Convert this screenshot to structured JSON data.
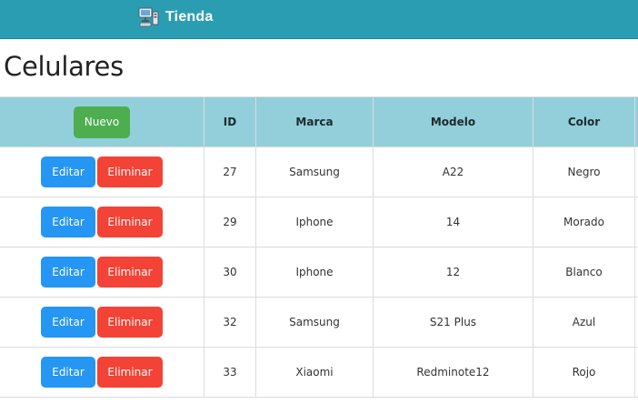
{
  "nav": {
    "brand": "Tienda",
    "brand_icon": "computer-store-icon"
  },
  "page": {
    "title": "Celulares"
  },
  "table": {
    "new_label": "Nuevo",
    "headers": [
      "ID",
      "Marca",
      "Modelo",
      "Color"
    ],
    "edit_label": "Editar",
    "delete_label": "Eliminar",
    "rows": [
      {
        "id": "27",
        "marca": "Samsung",
        "modelo": "A22",
        "color": "Negro"
      },
      {
        "id": "29",
        "marca": "Iphone",
        "modelo": "14",
        "color": "Morado"
      },
      {
        "id": "30",
        "marca": "Iphone",
        "modelo": "12",
        "color": "Blanco"
      },
      {
        "id": "32",
        "marca": "Samsung",
        "modelo": "S21 Plus",
        "color": "Azul"
      },
      {
        "id": "33",
        "marca": "Xiaomi",
        "modelo": "Redminote12",
        "color": "Rojo"
      }
    ]
  },
  "colors": {
    "navbar": "#2b9db3",
    "table_header": "#92cfdb",
    "new_button": "#4cae4f",
    "edit_button": "#2596f3",
    "delete_button": "#f34336"
  }
}
